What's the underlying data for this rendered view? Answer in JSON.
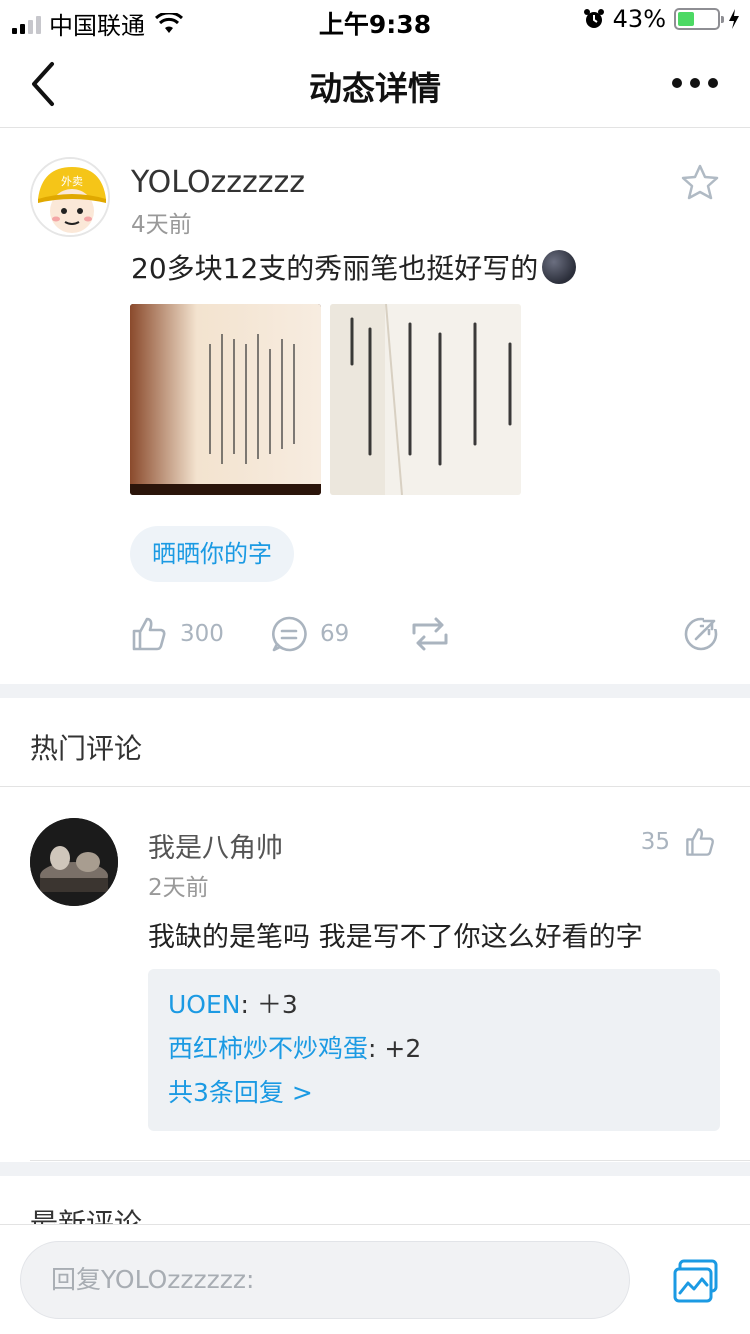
{
  "status_bar": {
    "carrier": "中国联通",
    "time": "上午9:38",
    "battery_percent": "43%",
    "battery_level": 0.43,
    "icons": [
      "signal-icon",
      "wifi-icon",
      "alarm-icon",
      "battery-icon",
      "charging-icon"
    ]
  },
  "nav": {
    "title": "动态详情",
    "back_icon": "chevron-left-icon",
    "more_icon": "more-dots-icon"
  },
  "post": {
    "username": "YOLOzzzzzz",
    "time": "4天前",
    "text": "20多块12支的秀丽笔也挺好写的",
    "emoji": "new-moon-face",
    "avatar_badge": "外卖",
    "topic": "晒晒你的字",
    "actions": {
      "likes": "300",
      "comments": "69"
    }
  },
  "hot_comments": {
    "title": "热门评论",
    "items": [
      {
        "username": "我是八角帅",
        "time": "2天前",
        "likes": "35",
        "text": "我缺的是笔吗 我是写不了你这么好看的字",
        "replies": [
          {
            "name": "UOEN",
            "text": "＋3"
          },
          {
            "name": "西红柿炒不炒鸡蛋",
            "text": "+2"
          }
        ],
        "more_replies": "共3条回复 >"
      }
    ]
  },
  "latest_comments": {
    "title": "最新评论"
  },
  "input": {
    "placeholder": "回复YOLOzzzzzz:"
  },
  "colors": {
    "accent": "#1b9ae3",
    "separator": "#f0f2f5",
    "muted": "#aab4bf",
    "battery": "#4cd964"
  }
}
